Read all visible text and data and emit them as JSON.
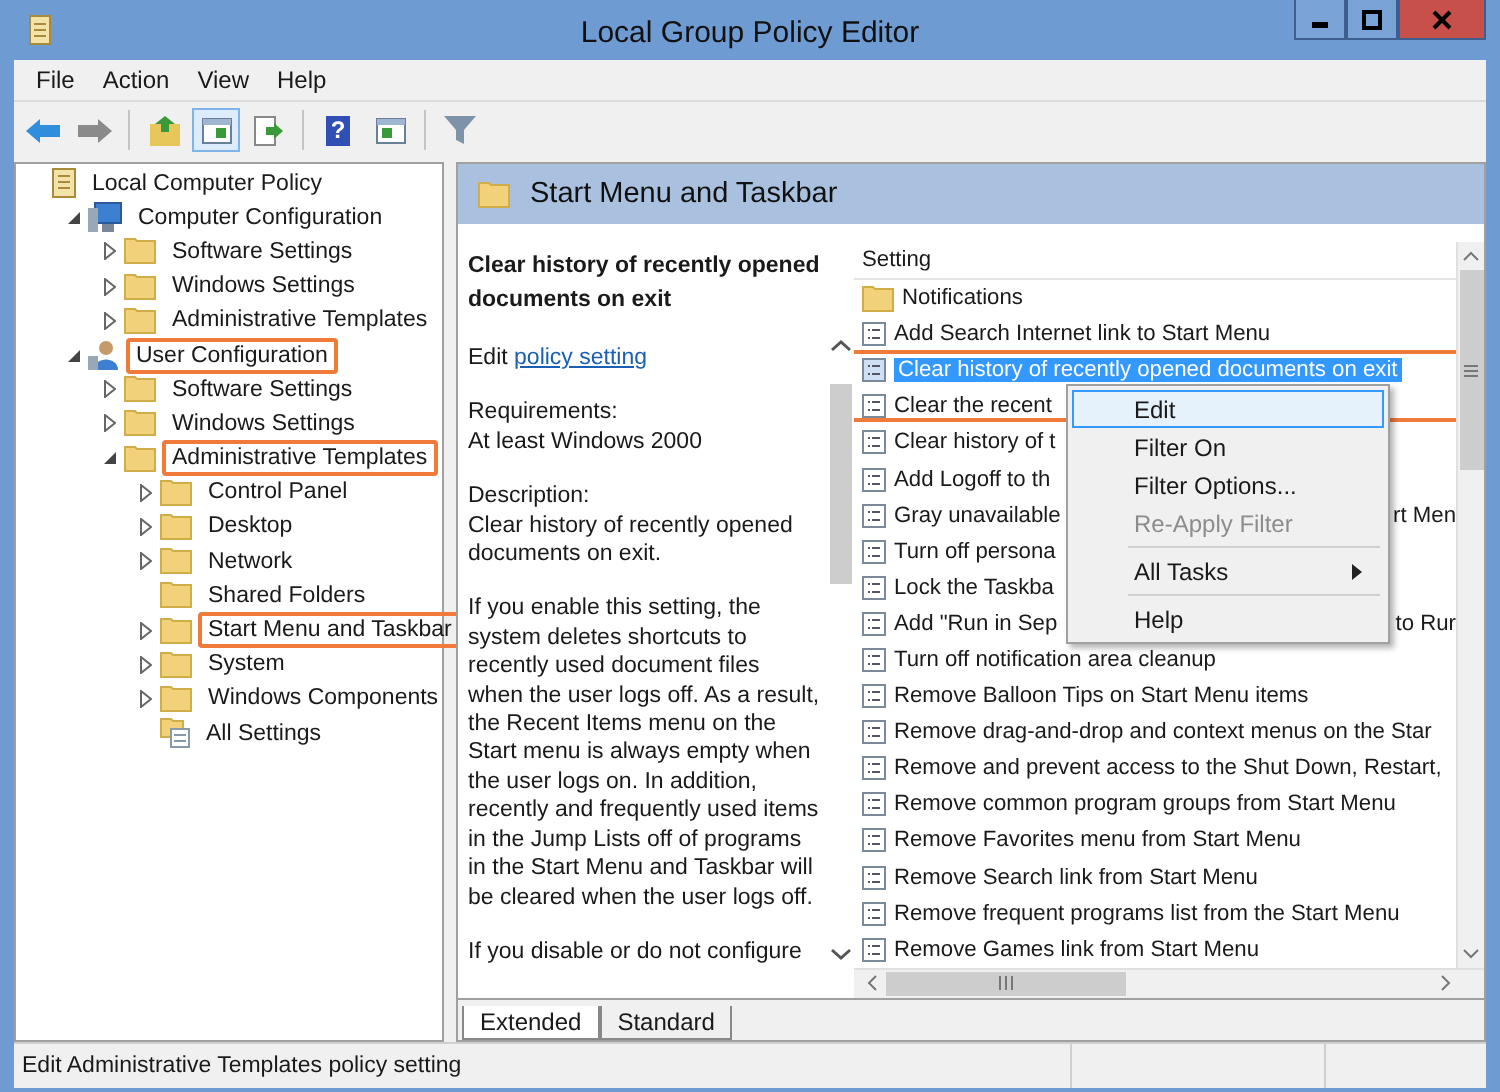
{
  "window": {
    "title": "Local Group Policy Editor"
  },
  "menu": [
    "File",
    "Action",
    "View",
    "Help"
  ],
  "toolbar": [
    [
      {
        "kind": "back",
        "selected": false
      },
      {
        "kind": "forward",
        "selected": false
      }
    ],
    [
      {
        "kind": "up",
        "selected": false
      },
      {
        "kind": "tree",
        "selected": true
      },
      {
        "kind": "export",
        "selected": false
      }
    ],
    [
      {
        "kind": "help",
        "label": "?",
        "selected": false
      },
      {
        "kind": "pane",
        "selected": false
      }
    ],
    [
      {
        "kind": "filter",
        "selected": false
      }
    ]
  ],
  "tree": [
    {
      "label": "Local Computer Policy",
      "kind": "policy",
      "highlighted": false,
      "children": [
        {
          "label": "Computer Configuration",
          "kind": "computer",
          "expanded": true,
          "highlighted": false,
          "children": [
            {
              "label": "Software Settings",
              "kind": "folder",
              "expanded": false,
              "highlighted": false
            },
            {
              "label": "Windows Settings",
              "kind": "folder",
              "expanded": false,
              "highlighted": false
            },
            {
              "label": "Administrative Templates",
              "kind": "folder",
              "expanded": false,
              "highlighted": false
            }
          ]
        },
        {
          "label": "User Configuration",
          "kind": "user",
          "expanded": true,
          "highlighted": true,
          "children": [
            {
              "label": "Software Settings",
              "kind": "folder",
              "expanded": false,
              "highlighted": false
            },
            {
              "label": "Windows Settings",
              "kind": "folder",
              "expanded": false,
              "highlighted": false
            },
            {
              "label": "Administrative Templates",
              "kind": "folder",
              "expanded": true,
              "highlighted": true,
              "children": [
                {
                  "label": "Control Panel",
                  "kind": "folder",
                  "expanded": false,
                  "highlighted": false
                },
                {
                  "label": "Desktop",
                  "kind": "folder",
                  "expanded": false,
                  "highlighted": false
                },
                {
                  "label": "Network",
                  "kind": "folder",
                  "expanded": false,
                  "highlighted": false
                },
                {
                  "label": "Shared Folders",
                  "kind": "folder",
                  "highlighted": false
                },
                {
                  "label": "Start Menu and Taskbar",
                  "kind": "folder",
                  "expanded": false,
                  "highlighted": true
                },
                {
                  "label": "System",
                  "kind": "folder",
                  "expanded": false,
                  "highlighted": false
                },
                {
                  "label": "Windows Components",
                  "kind": "folder",
                  "expanded": false,
                  "highlighted": false
                },
                {
                  "label": "All Settings",
                  "kind": "settings",
                  "highlighted": false
                }
              ]
            }
          ]
        }
      ]
    }
  ],
  "header": {
    "title": "Start Menu and Taskbar"
  },
  "description": {
    "title": "Clear history of recently opened documents on exit",
    "edit_prefix": "Edit",
    "edit_link": "policy setting",
    "paragraphs": [
      "Requirements:\nAt least Windows 2000",
      "Description:\nClear history of recently opened documents on exit.",
      "If you enable this setting, the system deletes shortcuts to recently used document files when the user logs off. As a result, the Recent Items menu on the Start menu is always empty when the user logs on. In addition, recently and frequently used items in the Jump Lists off of programs in the Start Menu and Taskbar will be cleared when the user logs off.",
      "If you disable or do not configure"
    ]
  },
  "list": {
    "column": "Setting",
    "rows": [
      {
        "text": "Notifications",
        "kind": "folder",
        "selected": false,
        "highlighted": false
      },
      {
        "text": "Add Search Internet link to Start Menu",
        "kind": "setting",
        "selected": false,
        "highlighted": false
      },
      {
        "text": "Clear history of recently opened documents on exit",
        "kind": "setting",
        "selected": true,
        "highlighted": true
      },
      {
        "text": "Clear the recent",
        "kind": "setting",
        "selected": false,
        "highlighted": false
      },
      {
        "text": "Clear history of t",
        "kind": "setting",
        "selected": false,
        "highlighted": false
      },
      {
        "text": "Add Logoff to th",
        "kind": "setting",
        "selected": false,
        "highlighted": false
      },
      {
        "text": "Gray unavailable",
        "text_right": "rt Men",
        "kind": "setting",
        "selected": false,
        "highlighted": false
      },
      {
        "text": "Turn off persona",
        "kind": "setting",
        "selected": false,
        "highlighted": false
      },
      {
        "text": "Lock the Taskba",
        "kind": "setting",
        "selected": false,
        "highlighted": false
      },
      {
        "text": "Add \"Run in Sep",
        "text_right": "to Rur",
        "kind": "setting",
        "selected": false,
        "highlighted": false
      },
      {
        "text": "Turn off notification area cleanup",
        "kind": "setting",
        "selected": false,
        "highlighted": false
      },
      {
        "text": "Remove Balloon Tips on Start Menu items",
        "kind": "setting",
        "selected": false,
        "highlighted": false
      },
      {
        "text": "Remove drag-and-drop and context menus on the Star",
        "kind": "setting",
        "selected": false,
        "highlighted": false
      },
      {
        "text": "Remove and prevent access to the Shut Down, Restart,",
        "kind": "setting",
        "selected": false,
        "highlighted": false
      },
      {
        "text": "Remove common program groups from Start Menu",
        "kind": "setting",
        "selected": false,
        "highlighted": false
      },
      {
        "text": "Remove Favorites menu from Start Menu",
        "kind": "setting",
        "selected": false,
        "highlighted": false
      },
      {
        "text": "Remove Search link from Start Menu",
        "kind": "setting",
        "selected": false,
        "highlighted": false
      },
      {
        "text": "Remove frequent programs list from the Start Menu",
        "kind": "setting",
        "selected": false,
        "highlighted": false
      },
      {
        "text": "Remove Games link from Start Menu",
        "kind": "setting",
        "selected": false,
        "highlighted": false
      }
    ]
  },
  "context_menu": [
    {
      "kind": "item",
      "label": "Edit",
      "selected": true,
      "disabled": false
    },
    {
      "kind": "item",
      "label": "Filter On",
      "selected": false,
      "disabled": false
    },
    {
      "kind": "item",
      "label": "Filter Options...",
      "selected": false,
      "disabled": false
    },
    {
      "kind": "item",
      "label": "Re-Apply Filter",
      "selected": false,
      "disabled": true
    },
    {
      "kind": "separator"
    },
    {
      "kind": "submenu",
      "label": "All Tasks",
      "selected": false,
      "disabled": false
    },
    {
      "kind": "separator"
    },
    {
      "kind": "item",
      "label": "Help",
      "selected": false,
      "disabled": false
    }
  ],
  "tabs": [
    {
      "label": "Extended",
      "selected": true
    },
    {
      "label": "Standard",
      "selected": false
    }
  ],
  "status_bar": "Edit Administrative Templates policy setting"
}
